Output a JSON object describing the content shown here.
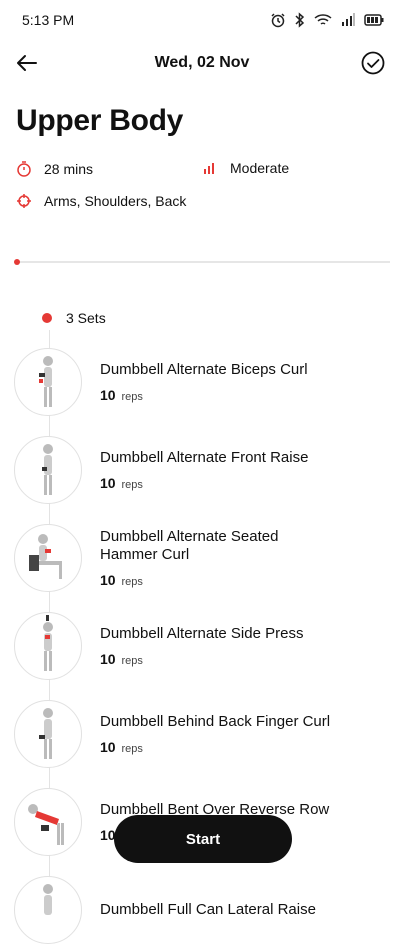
{
  "status_bar": {
    "time": "5:13 PM"
  },
  "header": {
    "date": "Wed, 02 Nov"
  },
  "workout": {
    "title": "Upper Body",
    "duration": "28 mins",
    "intensity": "Moderate",
    "targets": "Arms, Shoulders, Back"
  },
  "sets": {
    "label": "3 Sets"
  },
  "exercises": [
    {
      "name": "Dumbbell Alternate Biceps Curl",
      "reps": "10",
      "unit": "reps"
    },
    {
      "name": "Dumbbell Alternate Front Raise",
      "reps": "10",
      "unit": "reps"
    },
    {
      "name": "Dumbbell Alternate Seated Hammer Curl",
      "reps": "10",
      "unit": "reps"
    },
    {
      "name": "Dumbbell Alternate Side Press",
      "reps": "10",
      "unit": "reps"
    },
    {
      "name": "Dumbbell Behind Back Finger Curl",
      "reps": "10",
      "unit": "reps"
    },
    {
      "name": "Dumbbell Bent Over Reverse Row",
      "reps": "10",
      "unit": "reps"
    },
    {
      "name": "Dumbbell Full Can Lateral Raise",
      "reps": "",
      "unit": ""
    }
  ],
  "footer": {
    "start_label": "Start"
  },
  "colors": {
    "accent": "#e53935",
    "button_bg": "#111111"
  }
}
